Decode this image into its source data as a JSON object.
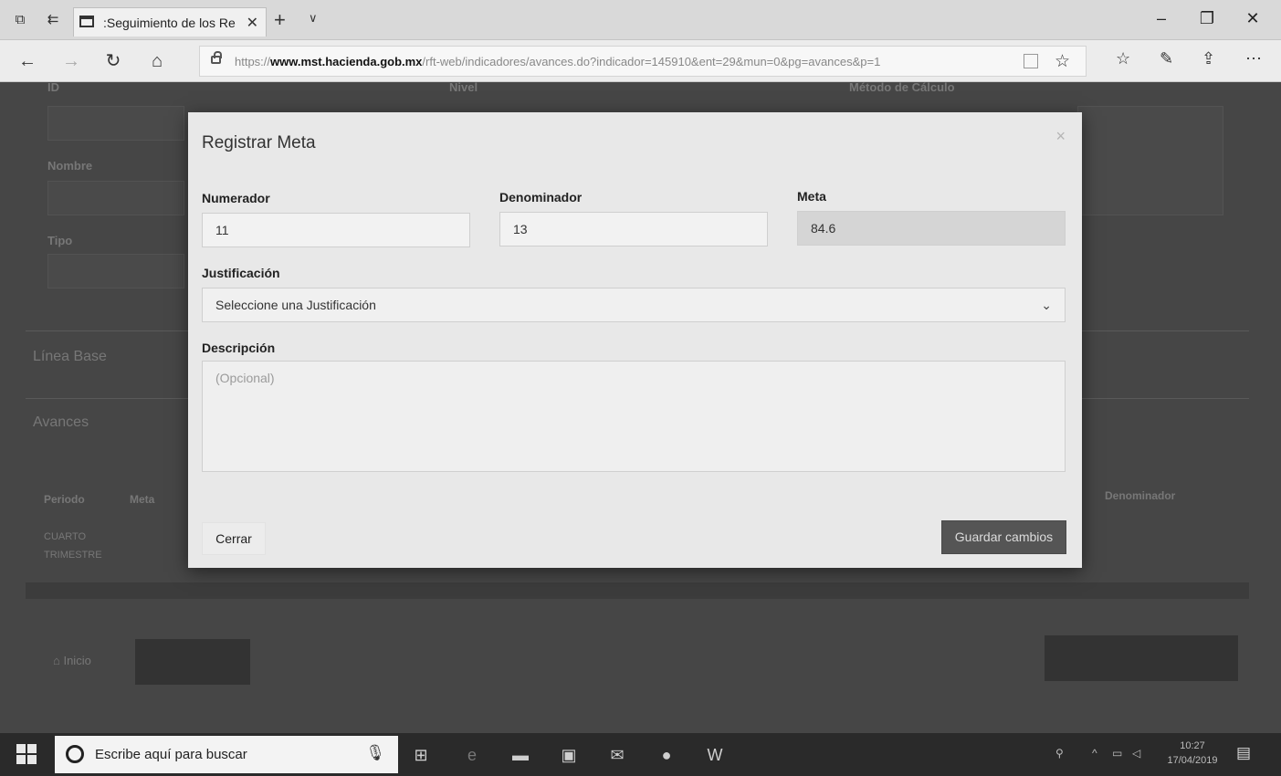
{
  "browser": {
    "tab_title": ":Seguimiento de los Re",
    "tab_close": "✕",
    "new_tab": "+",
    "tab_menu": "∨",
    "url_scheme": "https://",
    "url_host": "www.mst.hacienda.gob.mx",
    "url_path": "/rft-web/indicadores/avances.do?indicador=145910&ent=29&mun=0&pg=avances&p=1",
    "window_buttons": {
      "minimize": "–",
      "maximize": "❐",
      "close": "✕"
    }
  },
  "background_page": {
    "labels": {
      "id": "ID",
      "nivel": "Nivel",
      "metodo": "Método de Cálculo",
      "nombre": "Nombre",
      "tipo": "Tipo",
      "linea_base": "Línea Base",
      "avances": "Avances",
      "periodo": "Periodo",
      "meta": "Meta",
      "denominador": "Denominador",
      "cuarto": "CUARTO",
      "trimestre": "TRIMESTRE",
      "inicio": "Inicio"
    }
  },
  "modal": {
    "title": "Registrar Meta",
    "close_symbol": "×",
    "numerador": {
      "label": "Numerador",
      "value": "11"
    },
    "denominador": {
      "label": "Denominador",
      "value": "13"
    },
    "meta": {
      "label": "Meta",
      "value": "84.6"
    },
    "justificacion": {
      "label": "Justificación",
      "selected": "Seleccione una Justificación",
      "arrow": "⌄"
    },
    "descripcion": {
      "label": "Descripción",
      "placeholder": "(Opcional)"
    },
    "cerrar_label": "Cerrar",
    "guardar_label": "Guardar cambios"
  },
  "taskbar": {
    "search_placeholder": "Escribe aquí para buscar",
    "time": "10:27",
    "date": "17/04/2019"
  }
}
